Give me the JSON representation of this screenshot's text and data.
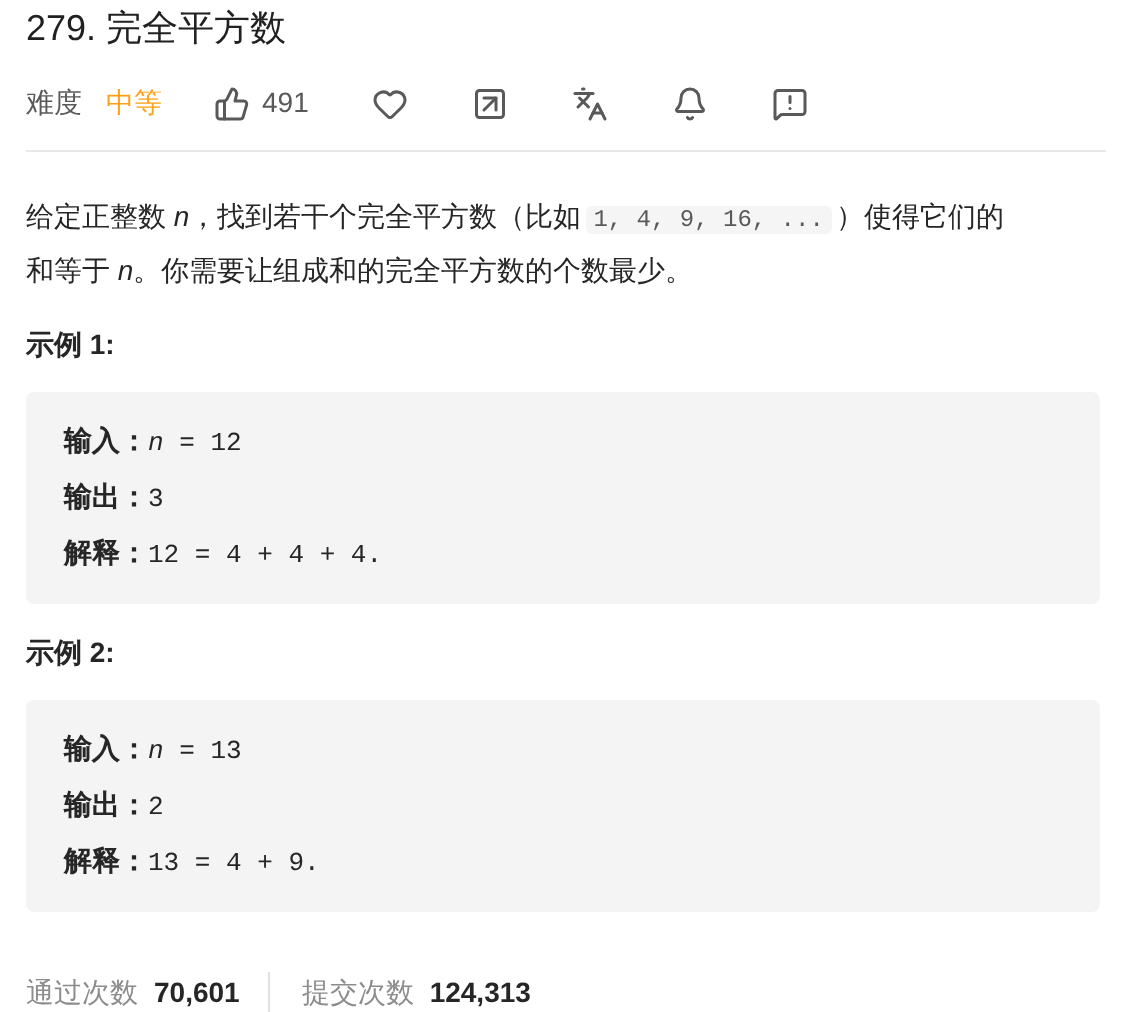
{
  "title": "279. 完全平方数",
  "meta": {
    "difficulty_label": "难度",
    "difficulty": "中等",
    "likes": "491"
  },
  "description": {
    "before": "给定正整数 *n*，找到若干个完全平方数（比如",
    "code": "1, 4, 9, 16, ...",
    "after": "）使得它们的和等于 *n*。你需要让组成和的完全平方数的个数最少。"
  },
  "examples": [
    {
      "heading": "示例 1:",
      "lines": [
        {
          "label": "输入：",
          "value": "*n* = 12"
        },
        {
          "label": "输出：",
          "value": "3"
        },
        {
          "label": "解释：",
          "value": "12 = 4 + 4 + 4."
        }
      ]
    },
    {
      "heading": "示例 2:",
      "lines": [
        {
          "label": "输入：",
          "value": "*n* = 13"
        },
        {
          "label": "输出：",
          "value": "2"
        },
        {
          "label": "解释：",
          "value": "13 = 4 + 9."
        }
      ]
    }
  ],
  "stats": [
    {
      "label": "通过次数",
      "value": "70,601"
    },
    {
      "label": "提交次数",
      "value": "124,313"
    }
  ]
}
